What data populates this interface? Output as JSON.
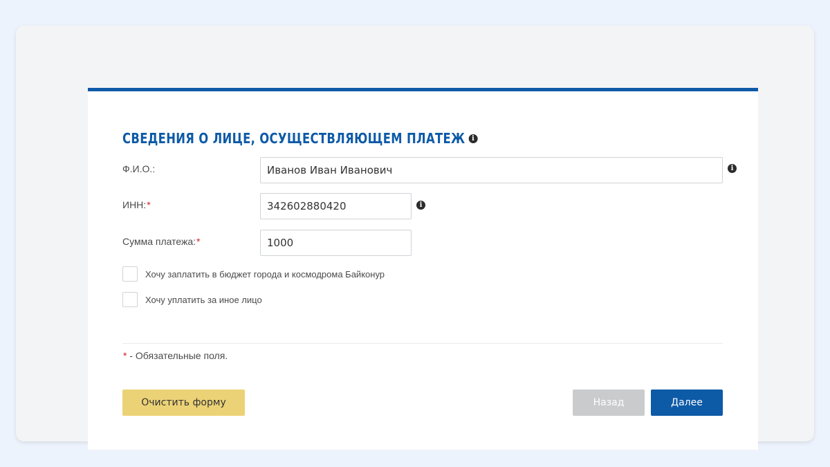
{
  "section": {
    "title": "СВЕДЕНИЯ О ЛИЦЕ, ОСУЩЕСТВЛЯЮЩЕМ ПЛАТЕЖ"
  },
  "info_glyph": "i",
  "required_mark": "*",
  "fields": {
    "fio": {
      "label": "Ф.И.О.:",
      "value": "Иванов Иван Иванович"
    },
    "inn": {
      "label": "ИНН:",
      "value": "342602880420"
    },
    "amount": {
      "label": "Сумма платежа:",
      "value": "1000"
    }
  },
  "checkboxes": [
    {
      "label": "Хочу заплатить в бюджет города и космодрома Байконур",
      "checked": false
    },
    {
      "label": "Хочу уплатить за иное лицо",
      "checked": false
    }
  ],
  "required_note": "- Обязательные поля.",
  "buttons": {
    "clear": "Очистить форму",
    "back": "Назад",
    "next": "Далее"
  },
  "colors": {
    "accent": "#0d5aa7",
    "clear_button": "#ecd276",
    "back_button": "#cacbcd",
    "required": "#d42020"
  },
  "icons": {
    "info": "info-icon"
  }
}
